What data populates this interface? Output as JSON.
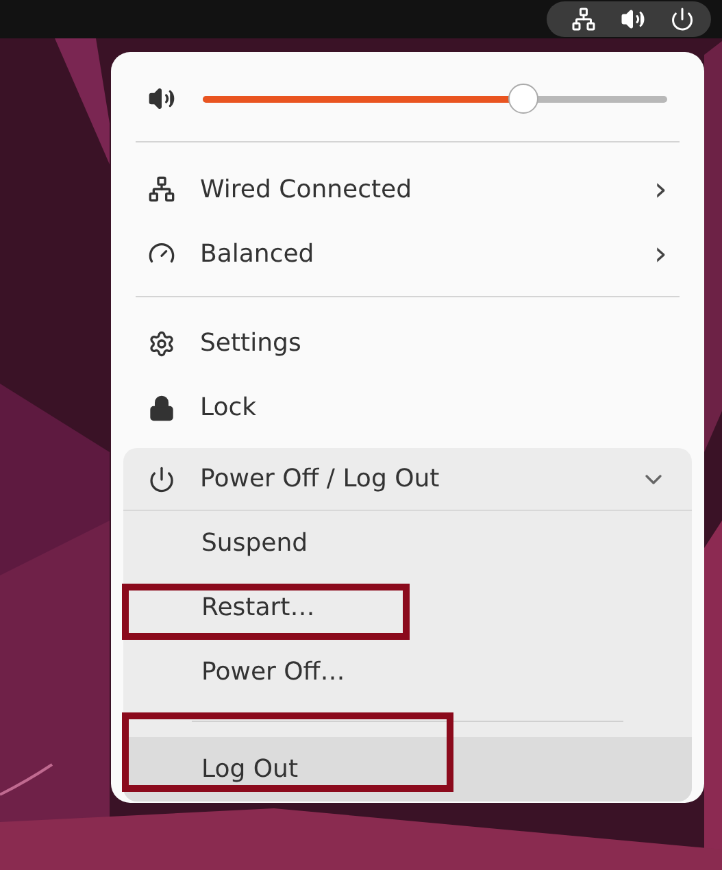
{
  "top_bar": {
    "indicators": [
      {
        "kind": "network"
      },
      {
        "kind": "volume"
      },
      {
        "kind": "power"
      }
    ]
  },
  "menu": {
    "volume": {
      "level": 0.69
    },
    "items": [
      {
        "kind": "network",
        "label": "Wired Connected",
        "arrow": "›"
      },
      {
        "kind": "power-mode",
        "label": "Balanced",
        "arrow": "›"
      },
      {
        "kind": "separator"
      },
      {
        "kind": "settings",
        "label": "Settings"
      },
      {
        "kind": "lock",
        "label": "Lock"
      }
    ],
    "power_section": {
      "label": "Power Off / Log Out",
      "expanded": true,
      "items": [
        {
          "label": "Suspend",
          "highlighted": false,
          "selected": false,
          "separator_before": false
        },
        {
          "label": "Restart…",
          "highlighted": true,
          "selected": false,
          "separator_before": false
        },
        {
          "label": "Power Off…",
          "highlighted": false,
          "selected": false,
          "separator_before": false
        },
        {
          "label": "Log Out",
          "highlighted": true,
          "selected": true,
          "separator_before": true
        }
      ]
    }
  }
}
